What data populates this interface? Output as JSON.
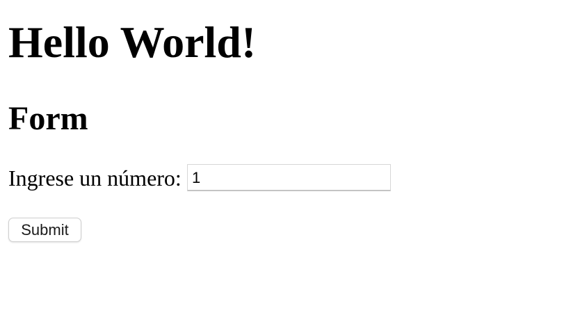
{
  "heading": "Hello World!",
  "form": {
    "title": "Form",
    "number_label": "Ingrese un número:",
    "number_value": "1",
    "submit_label": "Submit"
  }
}
